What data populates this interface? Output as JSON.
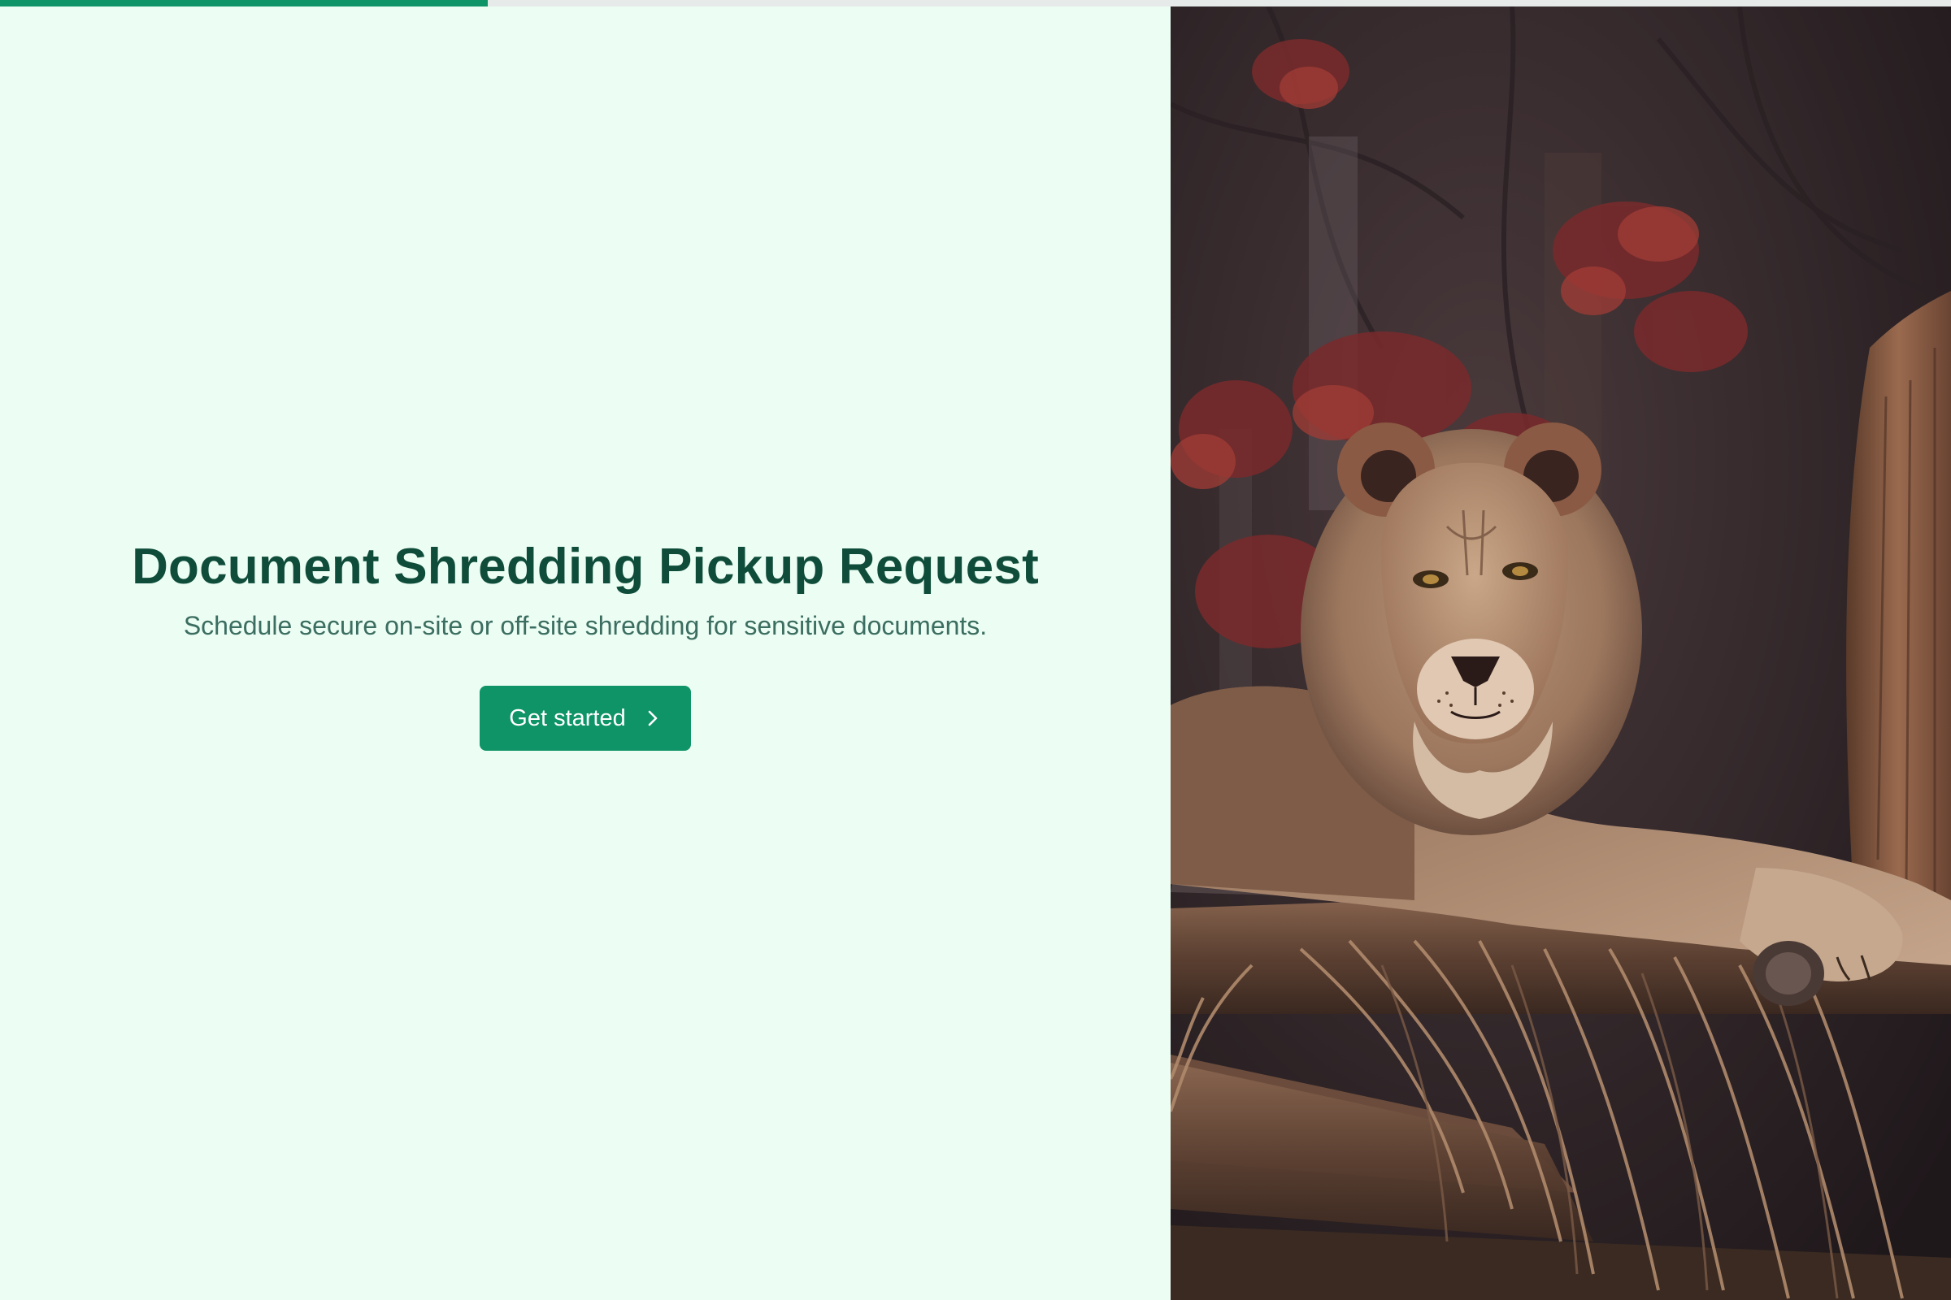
{
  "progress": {
    "fraction": 0.25,
    "color": "#0e9466",
    "track_color": "#e6ebe9"
  },
  "hero": {
    "title": "Document Shredding Pickup Request",
    "subtitle": "Schedule secure on-site or off-site shredding for sensitive documents.",
    "title_color": "#0f4d3a",
    "subtitle_color": "#3b6e60"
  },
  "cta": {
    "label": "Get started",
    "icon": "chevron-right-icon",
    "color": "#0e9466"
  },
  "image": {
    "subject": "lion-resting-on-logs-photo"
  }
}
